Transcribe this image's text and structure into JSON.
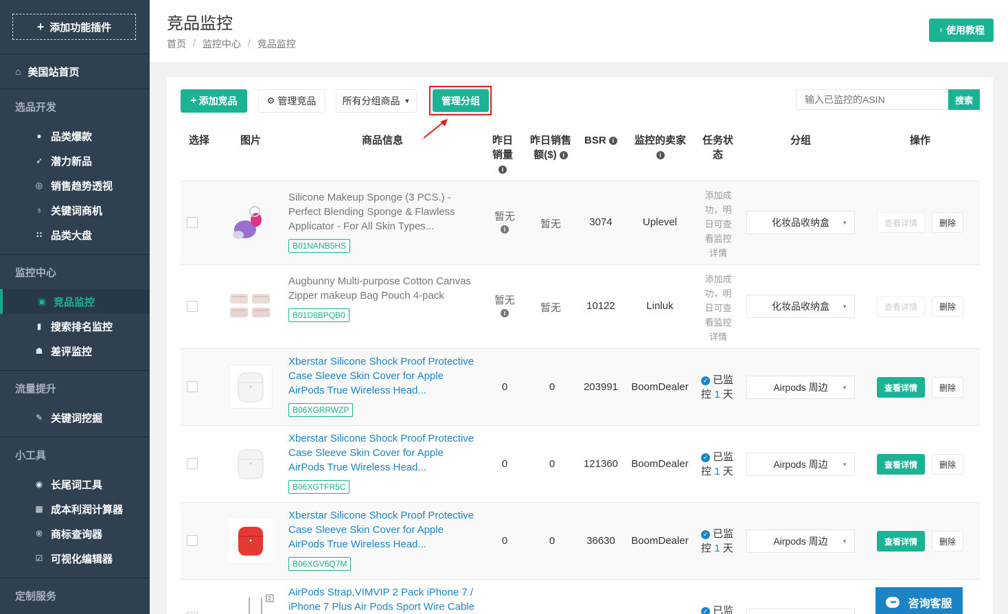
{
  "sidebar": {
    "addon": {
      "icon": "plus-icon",
      "label": "添加功能插件"
    },
    "home": {
      "icon": "home-icon",
      "label": "美国站首页"
    },
    "sections": [
      {
        "title": "选品开发",
        "items": [
          {
            "icon": "bomb-icon",
            "label": "品类爆款"
          },
          {
            "icon": "rocket-icon",
            "label": "潜力新品"
          },
          {
            "icon": "target-icon",
            "label": "销售趋势透视"
          },
          {
            "icon": "lightbulb-icon",
            "label": "关键词商机"
          },
          {
            "icon": "grid-icon",
            "label": "品类大盘"
          }
        ]
      },
      {
        "title": "监控中心",
        "items": [
          {
            "icon": "monitor-icon",
            "label": "竞品监控",
            "active": true
          },
          {
            "icon": "bar-chart-icon",
            "label": "搜索排名监控"
          },
          {
            "icon": "thumbs-down-icon",
            "label": "差评监控"
          }
        ]
      },
      {
        "title": "流量提升",
        "items": [
          {
            "icon": "pencil-icon",
            "label": "关键词挖掘"
          }
        ]
      },
      {
        "title": "小工具",
        "items": [
          {
            "icon": "circle-icon",
            "label": "长尾词工具"
          },
          {
            "icon": "calculator-icon",
            "label": "成本利润计算器"
          },
          {
            "icon": "registered-icon",
            "label": "商标查询器"
          },
          {
            "icon": "edit-icon",
            "label": "可视化编辑器"
          }
        ]
      },
      {
        "title": "定制服务",
        "items": []
      }
    ]
  },
  "header": {
    "title": "竞品监控",
    "breadcrumb": [
      "首页",
      "监控中心",
      "竞品监控"
    ],
    "tutorial_label": "使用教程"
  },
  "toolbar": {
    "add_label": "添加竞品",
    "manage_label": "管理竞品",
    "groups_label": "所有分组商品",
    "manage_groups_label": "管理分组",
    "search_placeholder": "输入已监控的ASIN",
    "search_label": "搜索"
  },
  "table": {
    "headers": {
      "select": "选择",
      "image": "图片",
      "info": "商品信息",
      "sales_1": "昨日",
      "sales_2": "销量",
      "revenue_1": "昨日销售",
      "revenue_2": "额($)",
      "bsr": "BSR",
      "seller_1": "监控的卖家",
      "status_1": "任务状",
      "status_2": "态",
      "group": "分组",
      "ops": "操作"
    },
    "rows": [
      {
        "name": "Silicone Makeup Sponge (3 PCS.) - Perfect Blending Sponge & Flawless Applicator - For All Skin Types...",
        "asin": "B01NANB5HS",
        "sales": "暂无",
        "revenue": "暂无",
        "bsr": "3074",
        "seller": "Uplevel",
        "status_pending": "添加成功，明日可查看监控详情",
        "group": "化妆品收纳盒",
        "detail": "查看详情",
        "delete": "删除"
      },
      {
        "name": "Augbunny Multi-purpose Cotton Canvas Zipper makeup Bag Pouch 4-pack",
        "asin": "B01D8BPQB0",
        "sales": "暂无",
        "revenue": "暂无",
        "bsr": "10122",
        "seller": "Linluk",
        "status_pending": "添加成功，明日可查看监控详情",
        "group": "化妆品收纳盒",
        "detail": "查看详情",
        "delete": "删除"
      },
      {
        "name": "Xberstar Silicone Shock Proof Protective Case Sleeve Skin Cover for Apple AirPods True Wireless Head...",
        "asin": "B06XGRRWZP",
        "sales": "0",
        "revenue": "0",
        "bsr": "203991",
        "seller": "BoomDealer",
        "status_a": "已监",
        "status_b": "控",
        "days": "1",
        "days_unit": "天",
        "group": "Airpods 周边",
        "detail": "查看详情",
        "delete": "删除"
      },
      {
        "name": "Xberstar Silicone Shock Proof Protective Case Sleeve Skin Cover for Apple AirPods True Wireless Head...",
        "asin": "B06XGTFR5C",
        "sales": "0",
        "revenue": "0",
        "bsr": "121360",
        "seller": "BoomDealer",
        "status_a": "已监",
        "status_b": "控",
        "days": "1",
        "days_unit": "天",
        "group": "Airpods 周边",
        "detail": "查看详情",
        "delete": "删除"
      },
      {
        "name": "Xberstar Silicone Shock Proof Protective Case Sleeve Skin Cover for Apple AirPods True Wireless Head...",
        "asin": "B06XGV6Q7M",
        "sales": "0",
        "revenue": "0",
        "bsr": "36630",
        "seller": "BoomDealer",
        "status_a": "已监",
        "status_b": "控",
        "days": "1",
        "days_unit": "天",
        "group": "Airpods 周边",
        "detail": "查看详情",
        "delete": "删除"
      },
      {
        "name": "AirPods Strap,VIMVIP 2 Pack iPhone 7 / iPhone 7 Plus Air Pods Sport Wire Cable",
        "status_a": "已监"
      }
    ]
  },
  "chat": {
    "label": "咨询客服",
    "icon": "chat-bubble-icon"
  },
  "colors": {
    "accent": "#1ab394",
    "link": "#1c84c6",
    "sidebar": "#2f4050",
    "highlight": "#e02020"
  }
}
